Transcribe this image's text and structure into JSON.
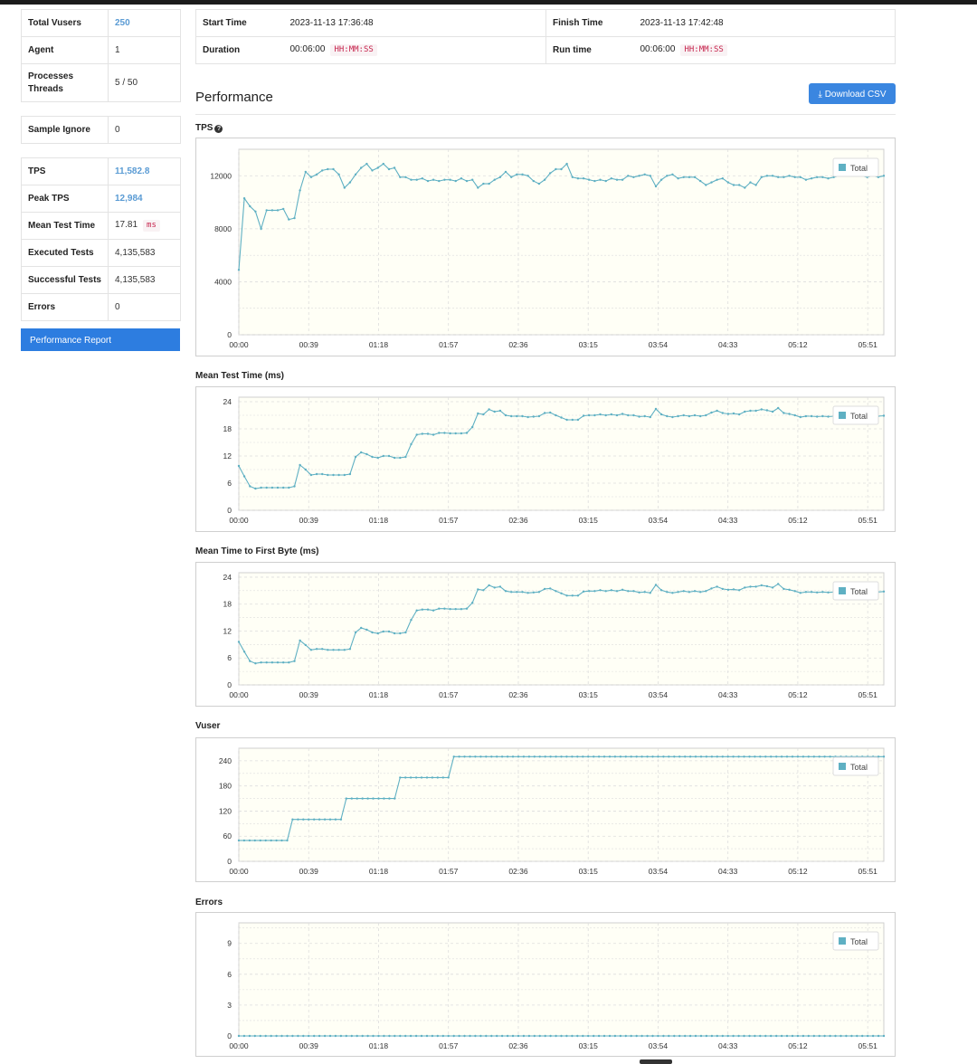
{
  "summary": {
    "total_vusers_label": "Total Vusers",
    "total_vusers": "250",
    "agent_label": "Agent",
    "agent": "1",
    "processes_threads_label_1": "Processes",
    "processes_threads_label_2": "Threads",
    "processes_threads": "5 / 50",
    "sample_ignore_label": "Sample Ignore",
    "sample_ignore": "0",
    "tps_label": "TPS",
    "tps": "11,582.8",
    "peak_tps_label": "Peak TPS",
    "peak_tps": "12,984",
    "mean_test_time_label": "Mean Test Time",
    "mean_test_time": "17.81",
    "mean_test_time_unit": "ms",
    "executed_tests_label": "Executed Tests",
    "executed_tests": "4,135,583",
    "successful_tests_label": "Successful Tests",
    "successful_tests": "4,135,583",
    "errors_label": "Errors",
    "errors": "0",
    "performance_report_button": "Performance Report"
  },
  "header": {
    "start_time_label": "Start Time",
    "start_time": "2023-11-13 17:36:48",
    "finish_time_label": "Finish Time",
    "finish_time": "2023-11-13 17:42:48",
    "duration_label": "Duration",
    "duration": "00:06:00",
    "duration_format": "HH:MM:SS",
    "run_time_label": "Run time",
    "run_time": "00:06:00",
    "run_time_format": "HH:MM:SS"
  },
  "performance": {
    "title": "Performance",
    "download_button": "Download CSV",
    "download_icon": "download-icon",
    "help_icon": "question-circle-icon"
  },
  "colors": {
    "line": "#5fb0c3",
    "plot_bg": "#fffff6",
    "grid": "#dddddd",
    "button": "#3a86e0"
  },
  "chart_data": [
    {
      "type": "line",
      "title": "TPS",
      "x": [
        "00:00",
        "00:39",
        "01:18",
        "01:57",
        "02:36",
        "03:15",
        "03:54",
        "04:33",
        "05:12",
        "05:51"
      ],
      "yticks": [
        0,
        4000,
        8000,
        12000
      ],
      "ylim": [
        0,
        14000
      ],
      "legend": "Total",
      "legend_position": "top-right",
      "series": [
        {
          "name": "Total",
          "values": [
            4900,
            10300,
            9700,
            9300,
            8000,
            9400,
            9400,
            9400,
            9500,
            8700,
            8800,
            10900,
            12300,
            11900,
            12100,
            12400,
            12500,
            12500,
            12100,
            11100,
            11500,
            12100,
            12600,
            12900,
            12400,
            12600,
            12900,
            12500,
            12600,
            11900,
            11900,
            11700,
            11700,
            11800,
            11600,
            11700,
            11600,
            11700,
            11700,
            11600,
            11800,
            11600,
            11700,
            11100,
            11400,
            11400,
            11700,
            11900,
            12300,
            11900,
            12100,
            12100,
            12000,
            11600,
            11400,
            11700,
            12200,
            12500,
            12500,
            12900,
            11900,
            11800,
            11800,
            11700,
            11600,
            11700,
            11600,
            11800,
            11700,
            11700,
            12000,
            11900,
            12000,
            12100,
            12000,
            11200,
            11700,
            12000,
            12100,
            11800,
            11900,
            11900,
            11900,
            11600,
            11300,
            11500,
            11700,
            11800,
            11500,
            11300,
            11300,
            11100,
            11500,
            11300,
            11900,
            12000,
            12000,
            11900,
            11900,
            12000,
            11900,
            11900,
            11700,
            11800,
            11900,
            11900,
            11800,
            11900,
            12000,
            12000,
            12000,
            12000,
            12000,
            11900,
            12000,
            11900,
            12000
          ]
        }
      ]
    },
    {
      "type": "line",
      "title": "Mean Test Time (ms)",
      "x": [
        "00:00",
        "00:39",
        "01:18",
        "01:57",
        "02:36",
        "03:15",
        "03:54",
        "04:33",
        "05:12",
        "05:51"
      ],
      "yticks": [
        0,
        6,
        12,
        18,
        24
      ],
      "ylim": [
        0,
        25
      ],
      "legend": "Total",
      "legend_position": "top-right",
      "series": [
        {
          "name": "Total",
          "values": [
            9.8,
            7.5,
            5.3,
            4.8,
            5.0,
            5.0,
            5.0,
            5.0,
            5.0,
            5.0,
            5.3,
            10.0,
            9.0,
            7.8,
            8.0,
            8.0,
            7.8,
            7.8,
            7.8,
            7.8,
            8.0,
            11.8,
            12.8,
            12.4,
            11.8,
            11.6,
            12.0,
            12.0,
            11.6,
            11.6,
            11.8,
            14.6,
            16.7,
            16.9,
            16.9,
            16.7,
            17.1,
            17.1,
            17.0,
            17.0,
            17.0,
            17.1,
            18.4,
            21.4,
            21.2,
            22.3,
            21.8,
            22.0,
            21.0,
            20.8,
            20.8,
            20.8,
            20.6,
            20.7,
            20.8,
            21.5,
            21.6,
            21.0,
            20.5,
            20.0,
            20.0,
            20.0,
            20.9,
            21.0,
            21.0,
            21.2,
            21.0,
            21.2,
            21.0,
            21.3,
            21.0,
            21.0,
            20.7,
            20.8,
            20.6,
            22.4,
            21.2,
            20.8,
            20.6,
            20.8,
            21.0,
            20.8,
            21.0,
            20.8,
            21.0,
            21.6,
            22.0,
            21.5,
            21.3,
            21.4,
            21.2,
            21.8,
            22.0,
            22.0,
            22.3,
            22.1,
            21.8,
            22.6,
            21.5,
            21.3,
            21.0,
            20.6,
            20.8,
            20.8,
            20.7,
            20.8,
            20.7,
            20.8,
            20.8,
            21.0,
            20.9,
            20.9,
            21.0,
            20.8,
            20.9,
            20.8,
            20.9
          ]
        }
      ]
    },
    {
      "type": "line",
      "title": "Mean Time to First Byte (ms)",
      "x": [
        "00:00",
        "00:39",
        "01:18",
        "01:57",
        "02:36",
        "03:15",
        "03:54",
        "04:33",
        "05:12",
        "05:51"
      ],
      "yticks": [
        0,
        6,
        12,
        18,
        24
      ],
      "ylim": [
        0,
        25
      ],
      "legend": "Total",
      "legend_position": "top-right",
      "series": [
        {
          "name": "Total",
          "values": [
            9.6,
            7.4,
            5.3,
            4.8,
            5.0,
            5.0,
            5.0,
            5.0,
            5.0,
            5.0,
            5.3,
            9.9,
            8.9,
            7.8,
            8.0,
            8.0,
            7.8,
            7.8,
            7.8,
            7.8,
            8.0,
            11.7,
            12.7,
            12.3,
            11.7,
            11.5,
            11.9,
            11.9,
            11.5,
            11.5,
            11.7,
            14.5,
            16.6,
            16.8,
            16.8,
            16.6,
            17.0,
            17.0,
            16.9,
            16.9,
            16.9,
            17.0,
            18.3,
            21.3,
            21.1,
            22.2,
            21.7,
            21.9,
            20.9,
            20.7,
            20.7,
            20.7,
            20.5,
            20.6,
            20.7,
            21.4,
            21.5,
            20.9,
            20.4,
            19.9,
            19.9,
            19.9,
            20.8,
            20.9,
            20.9,
            21.1,
            20.9,
            21.1,
            20.9,
            21.2,
            20.9,
            20.9,
            20.6,
            20.7,
            20.5,
            22.3,
            21.1,
            20.7,
            20.5,
            20.7,
            20.9,
            20.7,
            20.9,
            20.7,
            20.9,
            21.5,
            21.9,
            21.4,
            21.2,
            21.3,
            21.1,
            21.7,
            21.9,
            21.9,
            22.2,
            22.0,
            21.7,
            22.5,
            21.4,
            21.2,
            20.9,
            20.5,
            20.7,
            20.7,
            20.6,
            20.7,
            20.6,
            20.7,
            20.7,
            20.9,
            20.8,
            20.8,
            20.9,
            20.7,
            20.8,
            20.7,
            20.8
          ]
        }
      ]
    },
    {
      "type": "line",
      "title": "Vuser",
      "x": [
        "00:00",
        "00:39",
        "01:18",
        "01:57",
        "02:36",
        "03:15",
        "03:54",
        "04:33",
        "05:12",
        "05:51"
      ],
      "yticks": [
        0,
        60,
        120,
        180,
        240
      ],
      "ylim": [
        0,
        270
      ],
      "legend": "Total",
      "legend_position": "top-right",
      "steps": [
        {
          "t": 0,
          "v": 50
        },
        {
          "t": 30,
          "v": 100
        },
        {
          "t": 60,
          "v": 150
        },
        {
          "t": 90,
          "v": 200
        },
        {
          "t": 120,
          "v": 250
        }
      ],
      "series": [
        {
          "name": "Total",
          "values": []
        }
      ]
    },
    {
      "type": "line",
      "title": "Errors",
      "x": [
        "00:00",
        "00:39",
        "01:18",
        "01:57",
        "02:36",
        "03:15",
        "03:54",
        "04:33",
        "05:12",
        "05:51"
      ],
      "yticks": [
        0,
        3,
        6,
        9
      ],
      "ylim": [
        0,
        11
      ],
      "legend": "Total",
      "legend_position": "top-right",
      "series": [
        {
          "name": "Total",
          "values": []
        }
      ]
    }
  ]
}
